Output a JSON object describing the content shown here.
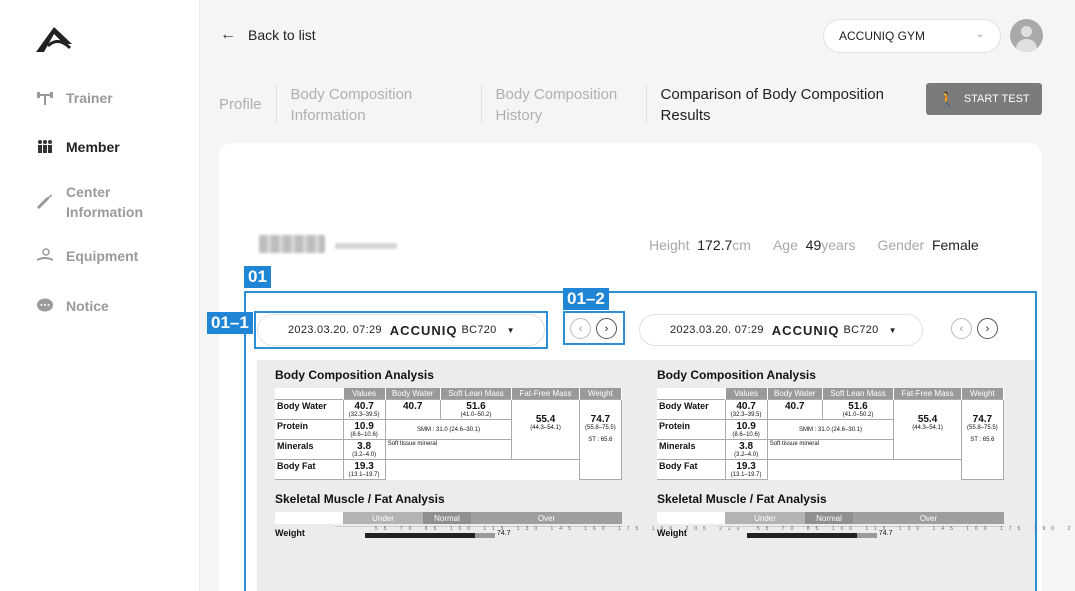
{
  "sidebar": {
    "items": [
      {
        "label": "Trainer",
        "icon": "dumbbell-icon"
      },
      {
        "label": "Member",
        "icon": "members-icon"
      },
      {
        "label": "Center\nInformation",
        "icon": "syringe-icon"
      },
      {
        "label": "Equipment",
        "icon": "equipment-icon"
      },
      {
        "label": "Notice",
        "icon": "chat-bubble-icon"
      }
    ]
  },
  "header": {
    "back_label": "Back to list",
    "gym": "ACCUNIQ GYM"
  },
  "tabs": [
    {
      "label": "Profile"
    },
    {
      "label": "Body Composition Information"
    },
    {
      "label": "Body Composition History"
    },
    {
      "label": "Comparison of Body Composition Results"
    }
  ],
  "start_test_label": "START TEST",
  "profile": {
    "height_label": "Height",
    "height_value": "172.7",
    "height_unit": "cm",
    "age_label": "Age",
    "age_value": "49",
    "age_unit": "years",
    "gender_label": "Gender",
    "gender_value": "Female"
  },
  "annotations": {
    "a": "01",
    "b": "01–1",
    "c": "01–2"
  },
  "selectors": [
    {
      "datetime": "2023.03.20. 07:29",
      "brand": "ACCUNIQ",
      "model": "BC720"
    },
    {
      "datetime": "2023.03.20. 07:29",
      "brand": "ACCUNIQ",
      "model": "BC720"
    }
  ],
  "report": {
    "title": "Body Composition Analysis",
    "headers": [
      "Values",
      "Body Water",
      "Soft Lean Mass",
      "Fat-Free Mass",
      "Weight"
    ],
    "rows": [
      {
        "label": "Body Water",
        "unit": "L",
        "value": "40.7",
        "range": "(32.3–39.5)"
      },
      {
        "label": "Protein",
        "unit": "kg",
        "value": "10.9",
        "range": "(8.6–10.6)"
      },
      {
        "label": "Minerals",
        "unit": "kg",
        "value": "3.8",
        "range": "(3.2–4.0)"
      },
      {
        "label": "Body Fat",
        "unit": "kg",
        "value": "19.3",
        "range": "(13.1–19.7)"
      }
    ],
    "body_water_total": "40.7",
    "slm_value": "51.6",
    "slm_range": "(41.0–50.2)",
    "ffm_value": "55.4",
    "ffm_range": "(44.3–54.1)",
    "weight_value": "74.7",
    "weight_range": "(55.8–75.5)",
    "smm_note": "SMM : 31.0 (24.6–30.1)",
    "soft_tissue": "Soft tissue mineral",
    "st_note": "ST : 65.6",
    "muscle_title": "Skeletal Muscle / Fat Analysis",
    "under": "Under",
    "normal": "Normal",
    "over": "Over",
    "weight_label": "Weight",
    "weight_bar_value": "74.7",
    "kg_unit": "kg",
    "ticks": "55 70 85 100 115 130 145 160 175 190 205 220",
    "pct": "[%]"
  },
  "colors": {
    "accent": "#1e86d4",
    "button": "#7b7b7b"
  }
}
